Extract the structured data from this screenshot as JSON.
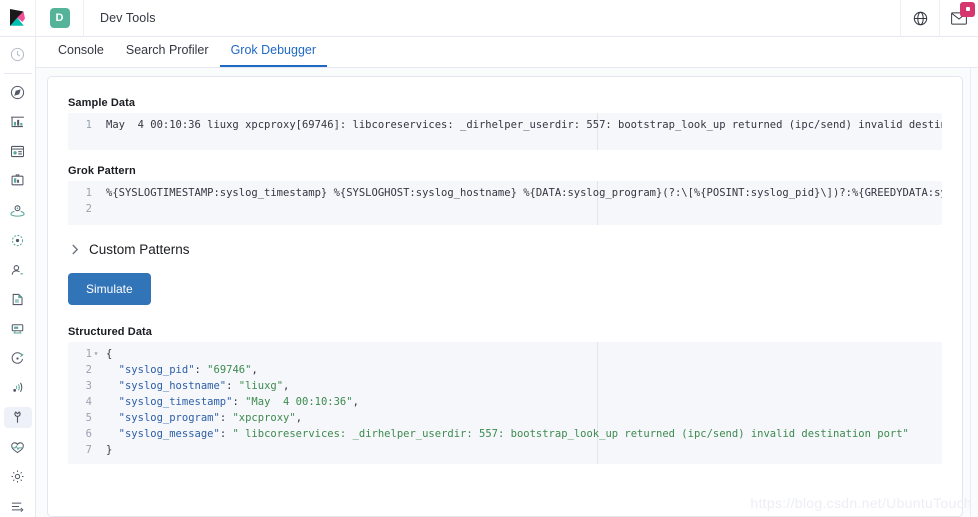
{
  "header": {
    "title": "Dev Tools",
    "space_badge": "D",
    "logo_name": "kibana-logo",
    "right_icons": [
      {
        "name": "help-globe-icon",
        "label": "Help"
      },
      {
        "name": "news-mail-icon",
        "label": "News"
      }
    ]
  },
  "leftnav": {
    "items": [
      {
        "name": "recently-viewed-icon",
        "label": "Recently viewed",
        "selected": false
      },
      {
        "name": "discover-compass-icon",
        "label": "Discover",
        "selected": false
      },
      {
        "name": "visualize-bar-icon",
        "label": "Visualize",
        "selected": false
      },
      {
        "name": "dashboard-icon",
        "label": "Dashboard",
        "selected": false
      },
      {
        "name": "canvas-icon",
        "label": "Canvas",
        "selected": false
      },
      {
        "name": "maps-icon",
        "label": "Maps",
        "selected": false
      },
      {
        "name": "machine-learning-icon",
        "label": "Machine Learning",
        "selected": false
      },
      {
        "name": "infrastructure-icon",
        "label": "Infrastructure",
        "selected": false
      },
      {
        "name": "logs-icon",
        "label": "Logs",
        "selected": false
      },
      {
        "name": "apm-icon",
        "label": "APM",
        "selected": false
      },
      {
        "name": "uptime-icon",
        "label": "Uptime",
        "selected": false
      },
      {
        "name": "siem-icon",
        "label": "SIEM",
        "selected": false
      },
      {
        "name": "dev-tools-wrench-icon",
        "label": "Dev Tools",
        "selected": true
      },
      {
        "name": "monitoring-icon",
        "label": "Monitoring",
        "selected": false
      },
      {
        "name": "management-gear-icon",
        "label": "Management",
        "selected": false
      },
      {
        "name": "collapse-nav-icon",
        "label": "Collapse",
        "selected": false
      }
    ]
  },
  "tabs": [
    {
      "label": "Console",
      "active": false
    },
    {
      "label": "Search Profiler",
      "active": false
    },
    {
      "label": "Grok Debugger",
      "active": true
    }
  ],
  "sample_data": {
    "label": "Sample Data",
    "line_numbers": [
      "1"
    ],
    "text": "May  4 00:10:36 liuxg xpcproxy[69746]: libcoreservices: _dirhelper_userdir: 557: bootstrap_look_up returned (ipc/send) invalid destination port"
  },
  "grok_pattern": {
    "label": "Grok Pattern",
    "line_numbers": [
      "1",
      "2"
    ],
    "text": "%{SYSLOGTIMESTAMP:syslog_timestamp} %{SYSLOGHOST:syslog_hostname} %{DATA:syslog_program}(?:\\[%{POSINT:syslog_pid}\\])?:%{GREEDYDATA:syslog_message}"
  },
  "custom_patterns": {
    "label": "Custom Patterns",
    "expanded": false,
    "chevron": "›"
  },
  "simulate_button": {
    "label": "Simulate",
    "color": "#3174b8"
  },
  "structured_data": {
    "label": "Structured Data",
    "line_numbers": [
      "1",
      "2",
      "3",
      "4",
      "5",
      "6",
      "7"
    ],
    "lines": [
      {
        "punc_open": "{"
      },
      {
        "key": "\"syslog_pid\"",
        "value": "\"69746\"",
        "comma": ","
      },
      {
        "key": "\"syslog_hostname\"",
        "value": "\"liuxg\"",
        "comma": ","
      },
      {
        "key": "\"syslog_timestamp\"",
        "value": "\"May  4 00:10:36\"",
        "comma": ","
      },
      {
        "key": "\"syslog_program\"",
        "value": "\"xpcproxy\"",
        "comma": ","
      },
      {
        "key": "\"syslog_message\"",
        "value": "\" libcoreservices: _dirhelper_userdir: 557: bootstrap_look_up returned (ipc/send) invalid destination port\"",
        "comma": ""
      },
      {
        "punc_close": "}"
      }
    ]
  },
  "watermark": {
    "text": "https://blog.csdn.net/UbuntuTouch"
  },
  "colors": {
    "accent": "#1f69c4",
    "button": "#3174b8",
    "badge": "#54b399",
    "notification": "#d6366e",
    "json_key": "#2c5fa8",
    "json_string": "#3d8a4f",
    "editor_bg": "#f5f7fa"
  }
}
